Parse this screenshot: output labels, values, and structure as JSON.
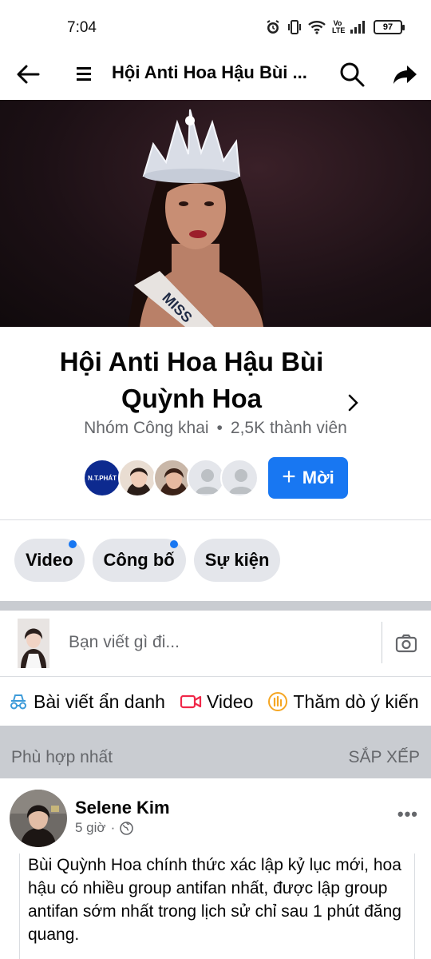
{
  "status_bar": {
    "time": "7:04",
    "battery": "97",
    "network_label": "Vo LTE"
  },
  "nav": {
    "title": "Hội Anti Hoa Hậu Bùi ..."
  },
  "group": {
    "name": "Hội Anti Hoa Hậu Bùi Quỳnh Hoa",
    "type": "Nhóm Công khai",
    "separator": "•",
    "members": "2,5K thành viên",
    "first_member_label": "N.T.PHÁT"
  },
  "invite_label": "Mời",
  "tabs": [
    {
      "label": "Video",
      "has_dot": true
    },
    {
      "label": "Công bố",
      "has_dot": true
    },
    {
      "label": "Sự kiện",
      "has_dot": false
    }
  ],
  "composer": {
    "placeholder": "Bạn viết gì đi..."
  },
  "actions": [
    {
      "label": "Bài viết ẩn danh",
      "icon": "incognito-icon"
    },
    {
      "label": "Video",
      "icon": "video-camera-icon"
    },
    {
      "label": "Thăm dò ý kiến",
      "icon": "poll-icon"
    }
  ],
  "feed_sort": {
    "left_label": "Phù hợp nhất",
    "right_label": "SẮP XẾP"
  },
  "post": {
    "author": "Selene Kim",
    "time": "5 giờ",
    "separator": "·",
    "body": "Bùi Quỳnh Hoa chính thức xác lập kỷ lục mới, hoa hậu có nhiều group antifan nhất, được lập group antifan sớm nhất trong lịch sử chỉ sau 1 phút đăng quang."
  },
  "colors": {
    "accent": "#1877f2",
    "secondary_text": "#65676b",
    "chip_bg": "#e4e6eb",
    "divider": "#c9ccd1"
  }
}
